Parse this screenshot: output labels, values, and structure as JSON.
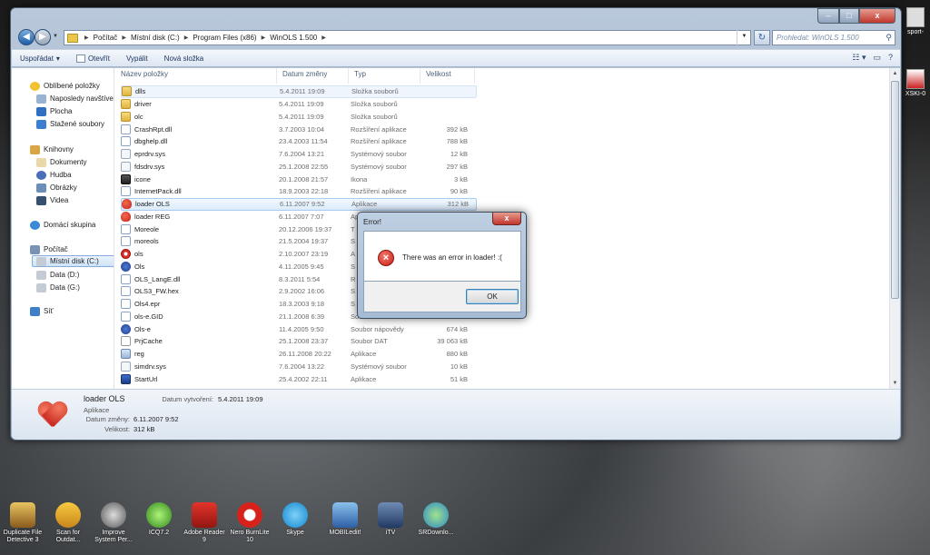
{
  "desktop_right": {
    "items": [
      {
        "label": "sport-"
      },
      {
        "label": "XSKI-0"
      }
    ]
  },
  "window": {
    "caption": {
      "minimize": "–",
      "maximize": "□",
      "close": "x"
    },
    "address": {
      "crumbs": [
        "Počítač",
        "Místní disk (C:)",
        "Program Files (x86)",
        "WinOLS 1.500"
      ],
      "search_placeholder": "Prohledat: WinOLS 1.500"
    },
    "toolbar": {
      "organize": "Uspořádat",
      "open": "Otevřít",
      "burn": "Vypálit",
      "new_folder": "Nová složka"
    },
    "nav": {
      "favorites": "Oblíbené položky",
      "recent": "Naposledy navštívené",
      "desktop": "Plocha",
      "downloads": "Stažené soubory",
      "libraries": "Knihovny",
      "documents": "Dokumenty",
      "music": "Hudba",
      "pictures": "Obrázky",
      "videos": "Videa",
      "homegroup": "Domácí skupina",
      "computer": "Počítač",
      "local_c": "Místní disk (C:)",
      "data_d": "Data (D:)",
      "data_g": "Data (G:)",
      "network": "Síť"
    },
    "columns": {
      "name": "Název položky",
      "date": "Datum změny",
      "type": "Typ",
      "size": "Velikost"
    },
    "files": [
      {
        "name": "dlls",
        "date": "5.4.2011 19:09",
        "type": "Složka souborů",
        "size": "",
        "icon": "folder"
      },
      {
        "name": "driver",
        "date": "5.4.2011 19:09",
        "type": "Složka souborů",
        "size": "",
        "icon": "folder"
      },
      {
        "name": "olc",
        "date": "5.4.2011 19:09",
        "type": "Složka souborů",
        "size": "",
        "icon": "folder"
      },
      {
        "name": "CrashRpt.dll",
        "date": "3.7.2003 10:04",
        "type": "Rozšíření aplikace",
        "size": "392 kB",
        "icon": "dll"
      },
      {
        "name": "dbghelp.dll",
        "date": "23.4.2003 11:54",
        "type": "Rozšíření aplikace",
        "size": "788 kB",
        "icon": "dll"
      },
      {
        "name": "eprdrv.sys",
        "date": "7.6.2004 13:21",
        "type": "Systémový soubor",
        "size": "12 kB",
        "icon": "sys"
      },
      {
        "name": "fdsdrv.sys",
        "date": "25.1.2008 22:55",
        "type": "Systémový soubor",
        "size": "297 kB",
        "icon": "sys"
      },
      {
        "name": "icone",
        "date": "20.1.2008 21:57",
        "type": "Ikona",
        "size": "3 kB",
        "icon": "ico"
      },
      {
        "name": "InternetPack.dll",
        "date": "18.9.2003 22:18",
        "type": "Rozšíření aplikace",
        "size": "90 kB",
        "icon": "dll"
      },
      {
        "name": "loader OLS",
        "date": "6.11.2007 9:52",
        "type": "Aplikace",
        "size": "312 kB",
        "icon": "heart"
      },
      {
        "name": "loader REG",
        "date": "6.11.2007 7:07",
        "type": "Ap",
        "size": "",
        "icon": "heart"
      },
      {
        "name": "Moreole",
        "date": "20.12.2006 19:37",
        "type": "T",
        "size": "",
        "icon": "dll"
      },
      {
        "name": "moreols",
        "date": "21.5.2004 19:37",
        "type": "S",
        "size": "",
        "icon": "dll"
      },
      {
        "name": "ols",
        "date": "2.10.2007 23:19",
        "type": "A",
        "size": "",
        "icon": "olsx"
      },
      {
        "name": "Ols",
        "date": "4.11.2005 9:45",
        "type": "S",
        "size": "",
        "icon": "ols"
      },
      {
        "name": "OLS_LangE.dll",
        "date": "8.3.2011 5:54",
        "type": "R",
        "size": "",
        "icon": "dll"
      },
      {
        "name": "OLS3_FW.hex",
        "date": "2.9.2002 16:06",
        "type": "S",
        "size": "",
        "icon": "dll"
      },
      {
        "name": "Ols4.epr",
        "date": "18.3.2003 9:18",
        "type": "S",
        "size": "",
        "icon": "dll"
      },
      {
        "name": "ols-e.GID",
        "date": "21.1.2008 6:39",
        "type": "Soubor GID",
        "size": "17 kB",
        "icon": "dll"
      },
      {
        "name": "Ols-e",
        "date": "11.4.2005 9:50",
        "type": "Soubor nápovědy",
        "size": "674 kB",
        "icon": "ols"
      },
      {
        "name": "PrjCache",
        "date": "25.1.2008 23:37",
        "type": "Soubor DAT",
        "size": "39 063 kB",
        "icon": "dat"
      },
      {
        "name": "reg",
        "date": "26.11.2008 20:22",
        "type": "Aplikace",
        "size": "880 kB",
        "icon": "app"
      },
      {
        "name": "simdrv.sys",
        "date": "7.6.2004 13:22",
        "type": "Systémový soubor",
        "size": "10 kB",
        "icon": "sys"
      },
      {
        "name": "StartUrl",
        "date": "25.4.2002 22:11",
        "type": "Aplikace",
        "size": "51 kB",
        "icon": "start"
      }
    ],
    "details": {
      "name": "loader OLS",
      "type": "Aplikace",
      "created_label": "Datum vytvoření:",
      "created_value": "5.4.2011 19:09",
      "modified_label": "Datum změny:",
      "modified_value": "6.11.2007 9:52",
      "size_label": "Velikost:",
      "size_value": "312 kB"
    }
  },
  "dialog": {
    "title": "Error!",
    "close": "x",
    "message": "There was an error in loader! :(",
    "ok": "OK"
  },
  "desktop_icons": [
    {
      "label": "Duplicate File Detective 3",
      "style": "g1"
    },
    {
      "label": "Scan for Outdat...",
      "style": "g2"
    },
    {
      "label": "Improve System Per...",
      "style": "g3"
    },
    {
      "label": "ICQ7.2",
      "style": "g4"
    },
    {
      "label": "Adobe Reader 9",
      "style": "g5"
    },
    {
      "label": "Nero BurnLite 10",
      "style": "g6"
    },
    {
      "label": "Skype",
      "style": "g7"
    },
    {
      "label": "MOBILedit!",
      "style": "g8"
    },
    {
      "label": "iTV",
      "style": "g9"
    },
    {
      "label": "SRDownlo...",
      "style": "g10"
    }
  ]
}
